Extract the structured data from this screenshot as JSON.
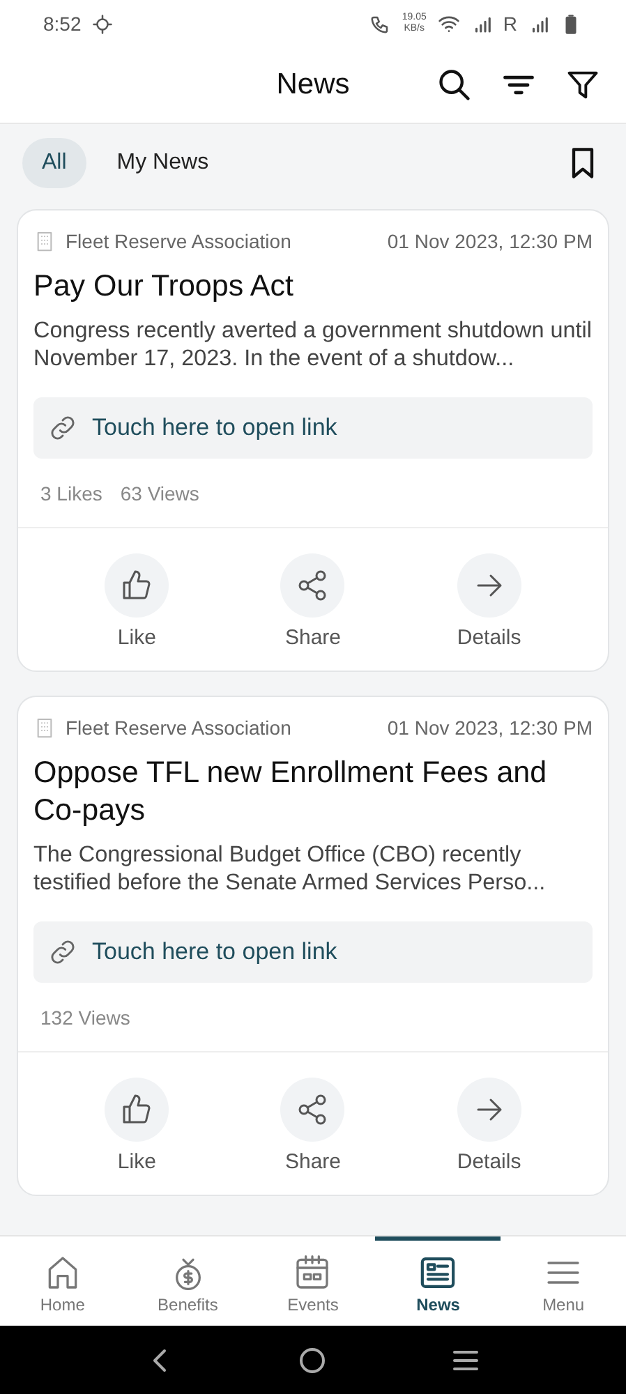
{
  "status_bar": {
    "time": "8:52",
    "speed": "19.05",
    "speed_unit": "KB/s",
    "roaming": "R"
  },
  "header": {
    "title": "News"
  },
  "tabs": [
    {
      "label": "All",
      "selected": true
    },
    {
      "label": "My News",
      "selected": false
    }
  ],
  "cards": [
    {
      "source": "Fleet Reserve Association",
      "date": "01 Nov 2023, 12:30 PM",
      "title": "Pay Our Troops Act",
      "summary": "Congress recently averted a government shutdown until November 17, 2023. In the event of a shutdow...",
      "link": "Touch here to open link",
      "stats": [
        "3 Likes",
        "63 Views"
      ],
      "actions": [
        {
          "kind": "like",
          "label": "Like"
        },
        {
          "kind": "share",
          "label": "Share"
        },
        {
          "kind": "details",
          "label": "Details"
        }
      ]
    },
    {
      "source": "Fleet Reserve Association",
      "date": "01 Nov 2023, 12:30 PM",
      "title": "Oppose TFL new Enrollment Fees and Co-pays",
      "summary": "The Congressional Budget Office (CBO) recently testified before the Senate Armed Services Perso...",
      "link": "Touch here to open link",
      "stats": [
        "132 Views"
      ],
      "actions": [
        {
          "kind": "like",
          "label": "Like"
        },
        {
          "kind": "share",
          "label": "Share"
        },
        {
          "kind": "details",
          "label": "Details"
        }
      ]
    }
  ],
  "bottom_nav": [
    {
      "kind": "home",
      "label": "Home",
      "selected": false
    },
    {
      "kind": "benefits",
      "label": "Benefits",
      "selected": false
    },
    {
      "kind": "events",
      "label": "Events",
      "selected": false
    },
    {
      "kind": "news",
      "label": "News",
      "selected": true
    },
    {
      "kind": "menu",
      "label": "Menu",
      "selected": false
    }
  ]
}
